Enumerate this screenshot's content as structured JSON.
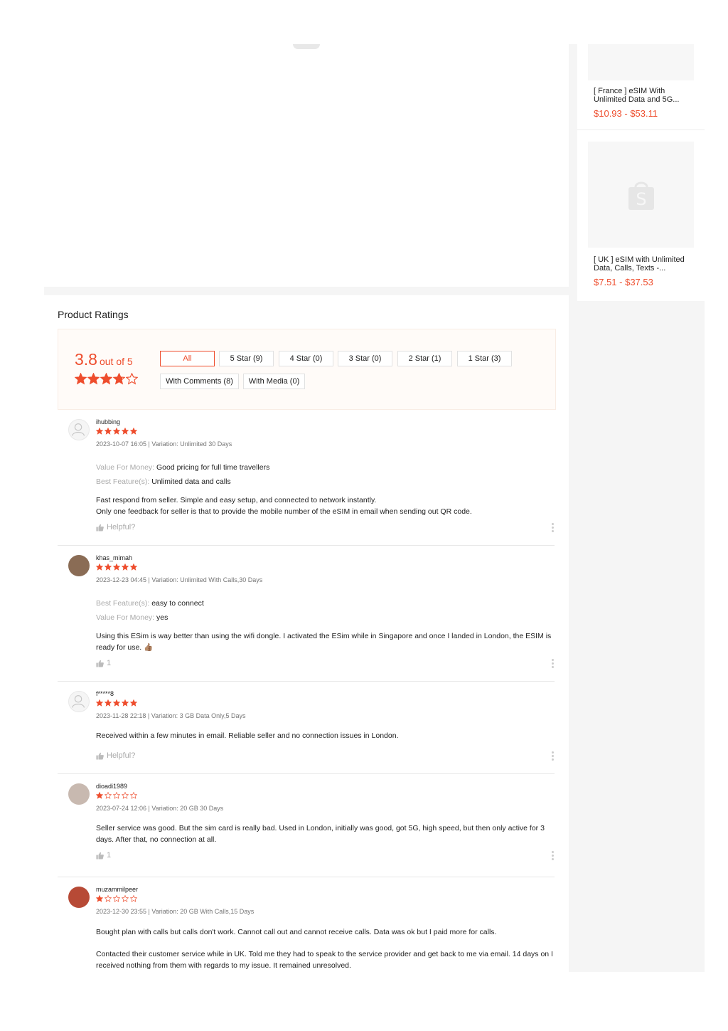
{
  "colors": {
    "accent": "#ee4d2d",
    "muted": "#aaaaaa",
    "panel": "#fffbf8"
  },
  "sidebar": {
    "items": [
      {
        "name": "[ France ] eSIM With Unlimited Data and 5G...",
        "price": "$10.93 - $53.11",
        "image": "product-image"
      },
      {
        "name": "[ UK ] eSIM with Unlimited Data, Calls, Texts -...",
        "price": "$7.51 - $37.53",
        "image": "shopee-bag-icon"
      }
    ]
  },
  "ratings": {
    "title": "Product Ratings",
    "score": "3.8",
    "score_suffix": "out of 5",
    "overall_stars": 3.8,
    "filters": [
      {
        "label": "All",
        "active": true
      },
      {
        "label": "5 Star (9)",
        "active": false
      },
      {
        "label": "4 Star (0)",
        "active": false
      },
      {
        "label": "3 Star (0)",
        "active": false
      },
      {
        "label": "2 Star (1)",
        "active": false
      },
      {
        "label": "1 Star (3)",
        "active": false
      },
      {
        "label": "With Comments (8)",
        "active": false
      },
      {
        "label": "With Media (0)",
        "active": false
      }
    ]
  },
  "reviews": [
    {
      "username": "ihubbing",
      "stars": 5,
      "meta": "2023-10-07 16:05 | Variation: Unlimited 30 Days",
      "attrs": [
        {
          "key": "Value For Money:",
          "value": "Good pricing for full time travellers"
        },
        {
          "key": "Best Feature(s):",
          "value": "Unlimited data and calls"
        }
      ],
      "body": [
        "Fast respond from seller. Simple and easy setup, and connected to network instantly.",
        "Only one feedback for seller is that to provide the mobile number of the eSIM in email when sending out QR code."
      ],
      "helpful": "Helpful?"
    },
    {
      "username": "khas_mimah",
      "stars": 5,
      "meta": "2023-12-23 04:45 | Variation: Unlimited With Calls,30 Days",
      "attrs": [
        {
          "key": "Best Feature(s):",
          "value": "easy to connect"
        },
        {
          "key": "Value For Money:",
          "value": "yes"
        }
      ],
      "body": [
        "Using this ESim is way better than using the wifi dongle. I activated the ESim while in Singapore and once I landed in London, the ESIM is ready for use. 👍🏽"
      ],
      "helpful": "1"
    },
    {
      "username": "f*****8",
      "stars": 5,
      "meta": "2023-11-28 22:18 | Variation: 3 GB Data Only,5 Days",
      "attrs": [],
      "body": [
        "Received within a few minutes in email. Reliable seller and no connection issues in London."
      ],
      "helpful": "Helpful?"
    },
    {
      "username": "dioadi1989",
      "stars": 1,
      "meta": "2023-07-24 12:06 | Variation: 20 GB 30 Days",
      "attrs": [],
      "body": [
        "Seller service was good. But the sim card is really bad. Used in London, initially was good, got 5G, high speed, but then only active for 3 days. After that, no connection at all."
      ],
      "helpful": "1"
    },
    {
      "username": "muzammilpeer",
      "stars": 1,
      "meta": "2023-12-30 23:55 | Variation: 20 GB With Calls,15 Days",
      "attrs": [],
      "body": [
        "Bought plan with calls but calls don't work. Cannot call out and cannot receive calls. Data was ok but I paid more for calls.",
        "",
        "Contacted their customer service while in UK. Told me they had to speak to the service provider and get back to me via email. 14 days on I received nothing from them with regards to my issue. It remained unresolved."
      ],
      "helpful": ""
    }
  ]
}
